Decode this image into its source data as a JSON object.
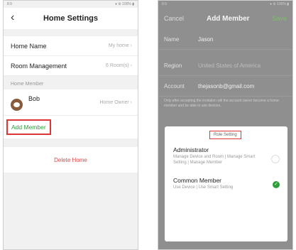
{
  "left": {
    "status_left": "8:9",
    "status_right": "♦ ⚙ 100% ▮",
    "nav_title": "Home Settings",
    "back_icon": "chevron-left-icon",
    "rows": [
      {
        "label": "Home Name",
        "value": "My home"
      },
      {
        "label": "Room Management",
        "value": "6 Room(s)"
      }
    ],
    "section_label": "Home Member",
    "member": {
      "name": "Bob",
      "role": "Home Owner"
    },
    "add_member": "Add Member",
    "delete_home": "Delete Home",
    "accent": "#2e9e39",
    "danger": "#e04848",
    "highlight": "#e03535"
  },
  "right": {
    "status_left": "8:9",
    "status_right": "♦ ⚙ 100% ▮",
    "cancel": "Cancel",
    "title": "Add Member",
    "save": "Save",
    "fields": [
      {
        "label": "Name",
        "value": "Jason"
      },
      {
        "label": "Region",
        "value": "United States of America"
      },
      {
        "label": "Account",
        "value": "thejasonb@gmail.com"
      }
    ],
    "note": "Only after accepting the invitation will the account owner become a home member and be able to use devices.",
    "sheet": {
      "title": "Role Setting",
      "roles": [
        {
          "name": "Administrator",
          "desc": "Manage Device and Room | Manage Smart Setting | Manage Member",
          "selected": false
        },
        {
          "name": "Common Member",
          "desc": "Use Device | Use Smart Setting",
          "selected": true
        }
      ]
    }
  }
}
